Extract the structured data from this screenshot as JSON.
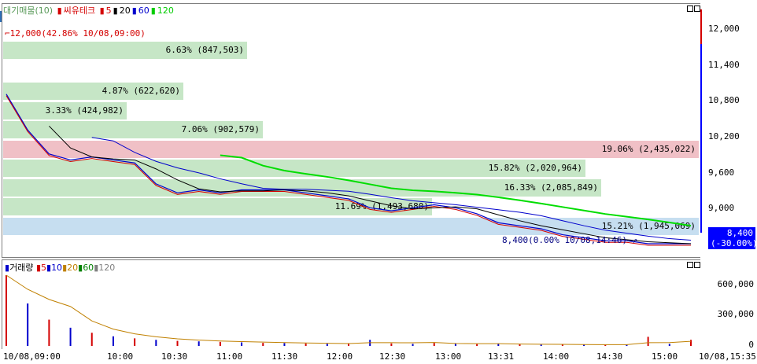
{
  "price_legend": {
    "title": "대기매물(10)",
    "stock_name": "씨유테크",
    "ma_items": [
      {
        "label": "5",
        "color": "#d40000"
      },
      {
        "label": "20",
        "color": "#000000"
      },
      {
        "label": "60",
        "color": "#0000cc"
      },
      {
        "label": "120",
        "color": "#00cc00"
      }
    ]
  },
  "volume_legend": {
    "title": "거래량",
    "ma_items": [
      {
        "label": "5",
        "color": "#d40000"
      },
      {
        "label": "10",
        "color": "#0000cc"
      },
      {
        "label": "20",
        "color": "#c08000"
      },
      {
        "label": "60",
        "color": "#008000"
      },
      {
        "label": "120",
        "color": "#808080"
      }
    ]
  },
  "corner_button": "호",
  "max_note": "12,000(42.86% 10/08,09:00)",
  "min_note": "8,400(0.00% 10/08,14:46)",
  "current_price": "8,400",
  "current_change": "(-30.00%)",
  "price_axis_labels": [
    "12,000",
    "11,400",
    "10,800",
    "10,200",
    "9,600",
    "9,000",
    "8,400"
  ],
  "volume_axis_labels": [
    "600,000",
    "300,000",
    "0"
  ],
  "time_labels": [
    "10/08,09:00",
    "10:00",
    "10:30",
    "11:00",
    "11:30",
    "12:00",
    "12:30",
    "13:00",
    "13:31",
    "14:00",
    "14:30",
    "15:00",
    "10/08,15:35"
  ],
  "colors": {
    "band_green": "#c6e6c6",
    "band_red": "#f0c0c6",
    "band_blue": "#c6def0",
    "up": "#d40000",
    "down": "#0000cc"
  },
  "chart_data": {
    "type": "line",
    "supply_bands": [
      {
        "label": "6.63% (847,503)",
        "percent": 6.63,
        "volume": 847503
      },
      {
        "label": "4.87% (622,620)",
        "percent": 4.87,
        "volume": 622620
      },
      {
        "label": "3.33% (424,982)",
        "percent": 3.33,
        "volume": 424982
      },
      {
        "label": "7.06% (902,579)",
        "percent": 7.06,
        "volume": 902579
      },
      {
        "label": "19.06% (2,435,022)",
        "percent": 19.06,
        "volume": 2435022
      },
      {
        "label": "15.82% (2,020,964)",
        "percent": 15.82,
        "volume": 2020964
      },
      {
        "label": "16.33% (2,085,849)",
        "percent": 16.33,
        "volume": 2085849
      },
      {
        "label": "11.69% (1,493,680)",
        "percent": 11.69,
        "volume": 1493680
      },
      {
        "label": "15.21% (1,945,069)",
        "percent": 15.21,
        "volume": 1945069
      }
    ],
    "price_series": {
      "name": "씨유테크",
      "x": [
        "09:00",
        "09:05",
        "09:10",
        "09:20",
        "09:30",
        "09:40",
        "09:50",
        "10:00",
        "10:10",
        "10:20",
        "10:30",
        "10:40",
        "10:50",
        "11:00",
        "11:15",
        "11:30",
        "11:45",
        "12:00",
        "12:10",
        "12:20",
        "12:30",
        "12:40",
        "12:50",
        "13:00",
        "13:15",
        "13:30",
        "13:45",
        "14:00",
        "14:15",
        "14:30",
        "14:46",
        "15:00",
        "15:20"
      ],
      "values": [
        10900,
        10300,
        9900,
        9800,
        9850,
        9800,
        9750,
        9400,
        9250,
        9300,
        9250,
        9300,
        9300,
        9300,
        9250,
        9200,
        9150,
        9000,
        8950,
        9000,
        9050,
        9000,
        8900,
        8750,
        8700,
        8650,
        8550,
        8500,
        8450,
        8450,
        8400,
        8400,
        8400
      ]
    },
    "volume_series": {
      "name": "거래량",
      "values": [
        700000,
        420000,
        260000,
        180000,
        130000,
        95000,
        75000,
        60000,
        50000,
        45000,
        40000,
        35000,
        30000,
        28000,
        25000,
        22000,
        20000,
        60000,
        25000,
        20000,
        30000,
        22000,
        18000,
        20000,
        15000,
        14000,
        12000,
        15000,
        10000,
        12000,
        90000,
        20000,
        60000
      ]
    },
    "ylim": [
      8400,
      12000
    ],
    "volume_ylim": [
      0,
      700000
    ]
  }
}
